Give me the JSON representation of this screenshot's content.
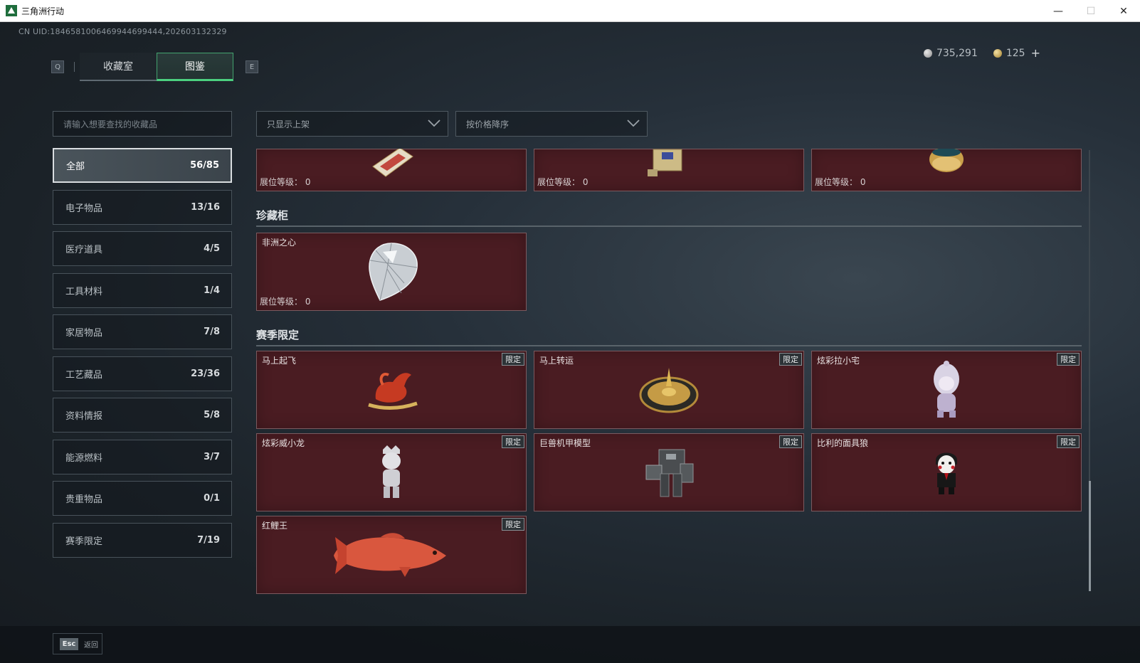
{
  "window": {
    "title": "三角洲行动",
    "minimize": "—",
    "maximize": "☐",
    "close": "✕"
  },
  "uid": "CN UID:1846581006469944699444,202603132329",
  "tabs": {
    "left_key": "Q",
    "right_key": "E",
    "items": [
      {
        "label": "收藏室",
        "active": false
      },
      {
        "label": "图鉴",
        "active": true
      }
    ]
  },
  "currency": {
    "silver": "735,291",
    "gold": "125",
    "add": "+"
  },
  "search": {
    "placeholder": "请输入想要查找的收藏品"
  },
  "filters": {
    "availability": "只显示上架",
    "sort": "按价格降序"
  },
  "categories": [
    {
      "label": "全部",
      "count": "56/85",
      "active": true
    },
    {
      "label": "电子物品",
      "count": "13/16"
    },
    {
      "label": "医疗道具",
      "count": "4/5"
    },
    {
      "label": "工具材料",
      "count": "1/4"
    },
    {
      "label": "家居物品",
      "count": "7/8"
    },
    {
      "label": "工艺藏品",
      "count": "23/36"
    },
    {
      "label": "资料情报",
      "count": "5/8"
    },
    {
      "label": "能源燃料",
      "count": "3/7"
    },
    {
      "label": "贵重物品",
      "count": "0/1"
    },
    {
      "label": "赛季限定",
      "count": "7/19"
    }
  ],
  "level_label": "展位等级：",
  "level_value": "0",
  "limited_badge": "限定",
  "top_row": [
    {
      "level": "展位等级： 0",
      "icon": "card-item-icon"
    },
    {
      "level": "展位等级： 0",
      "icon": "device-item-icon"
    },
    {
      "level": "展位等级： 0",
      "icon": "golden-pot-icon"
    }
  ],
  "sections": {
    "cabinet": {
      "title": "珍藏柜",
      "items": [
        {
          "name": "非洲之心",
          "level": "展位等级： 0",
          "icon": "diamond-icon"
        }
      ]
    },
    "season": {
      "title": "赛季限定",
      "items": [
        {
          "name": "马上起飞",
          "icon": "horse-icon"
        },
        {
          "name": "马上转运",
          "icon": "wheel-icon"
        },
        {
          "name": "炫彩拉小宅",
          "icon": "doll-icon"
        },
        {
          "name": "炫彩威小龙",
          "icon": "figure-icon"
        },
        {
          "name": "巨兽机甲模型",
          "icon": "mech-icon"
        },
        {
          "name": "比利的面具狼",
          "icon": "puppet-icon"
        },
        {
          "name": "红鲤王",
          "icon": "fish-icon"
        }
      ]
    }
  },
  "footer": {
    "esc_key": "Esc",
    "esc_label": "返回"
  },
  "colors": {
    "accent": "#4cd07f",
    "card_bg": "#4a1c22",
    "background": "#1c2329"
  }
}
